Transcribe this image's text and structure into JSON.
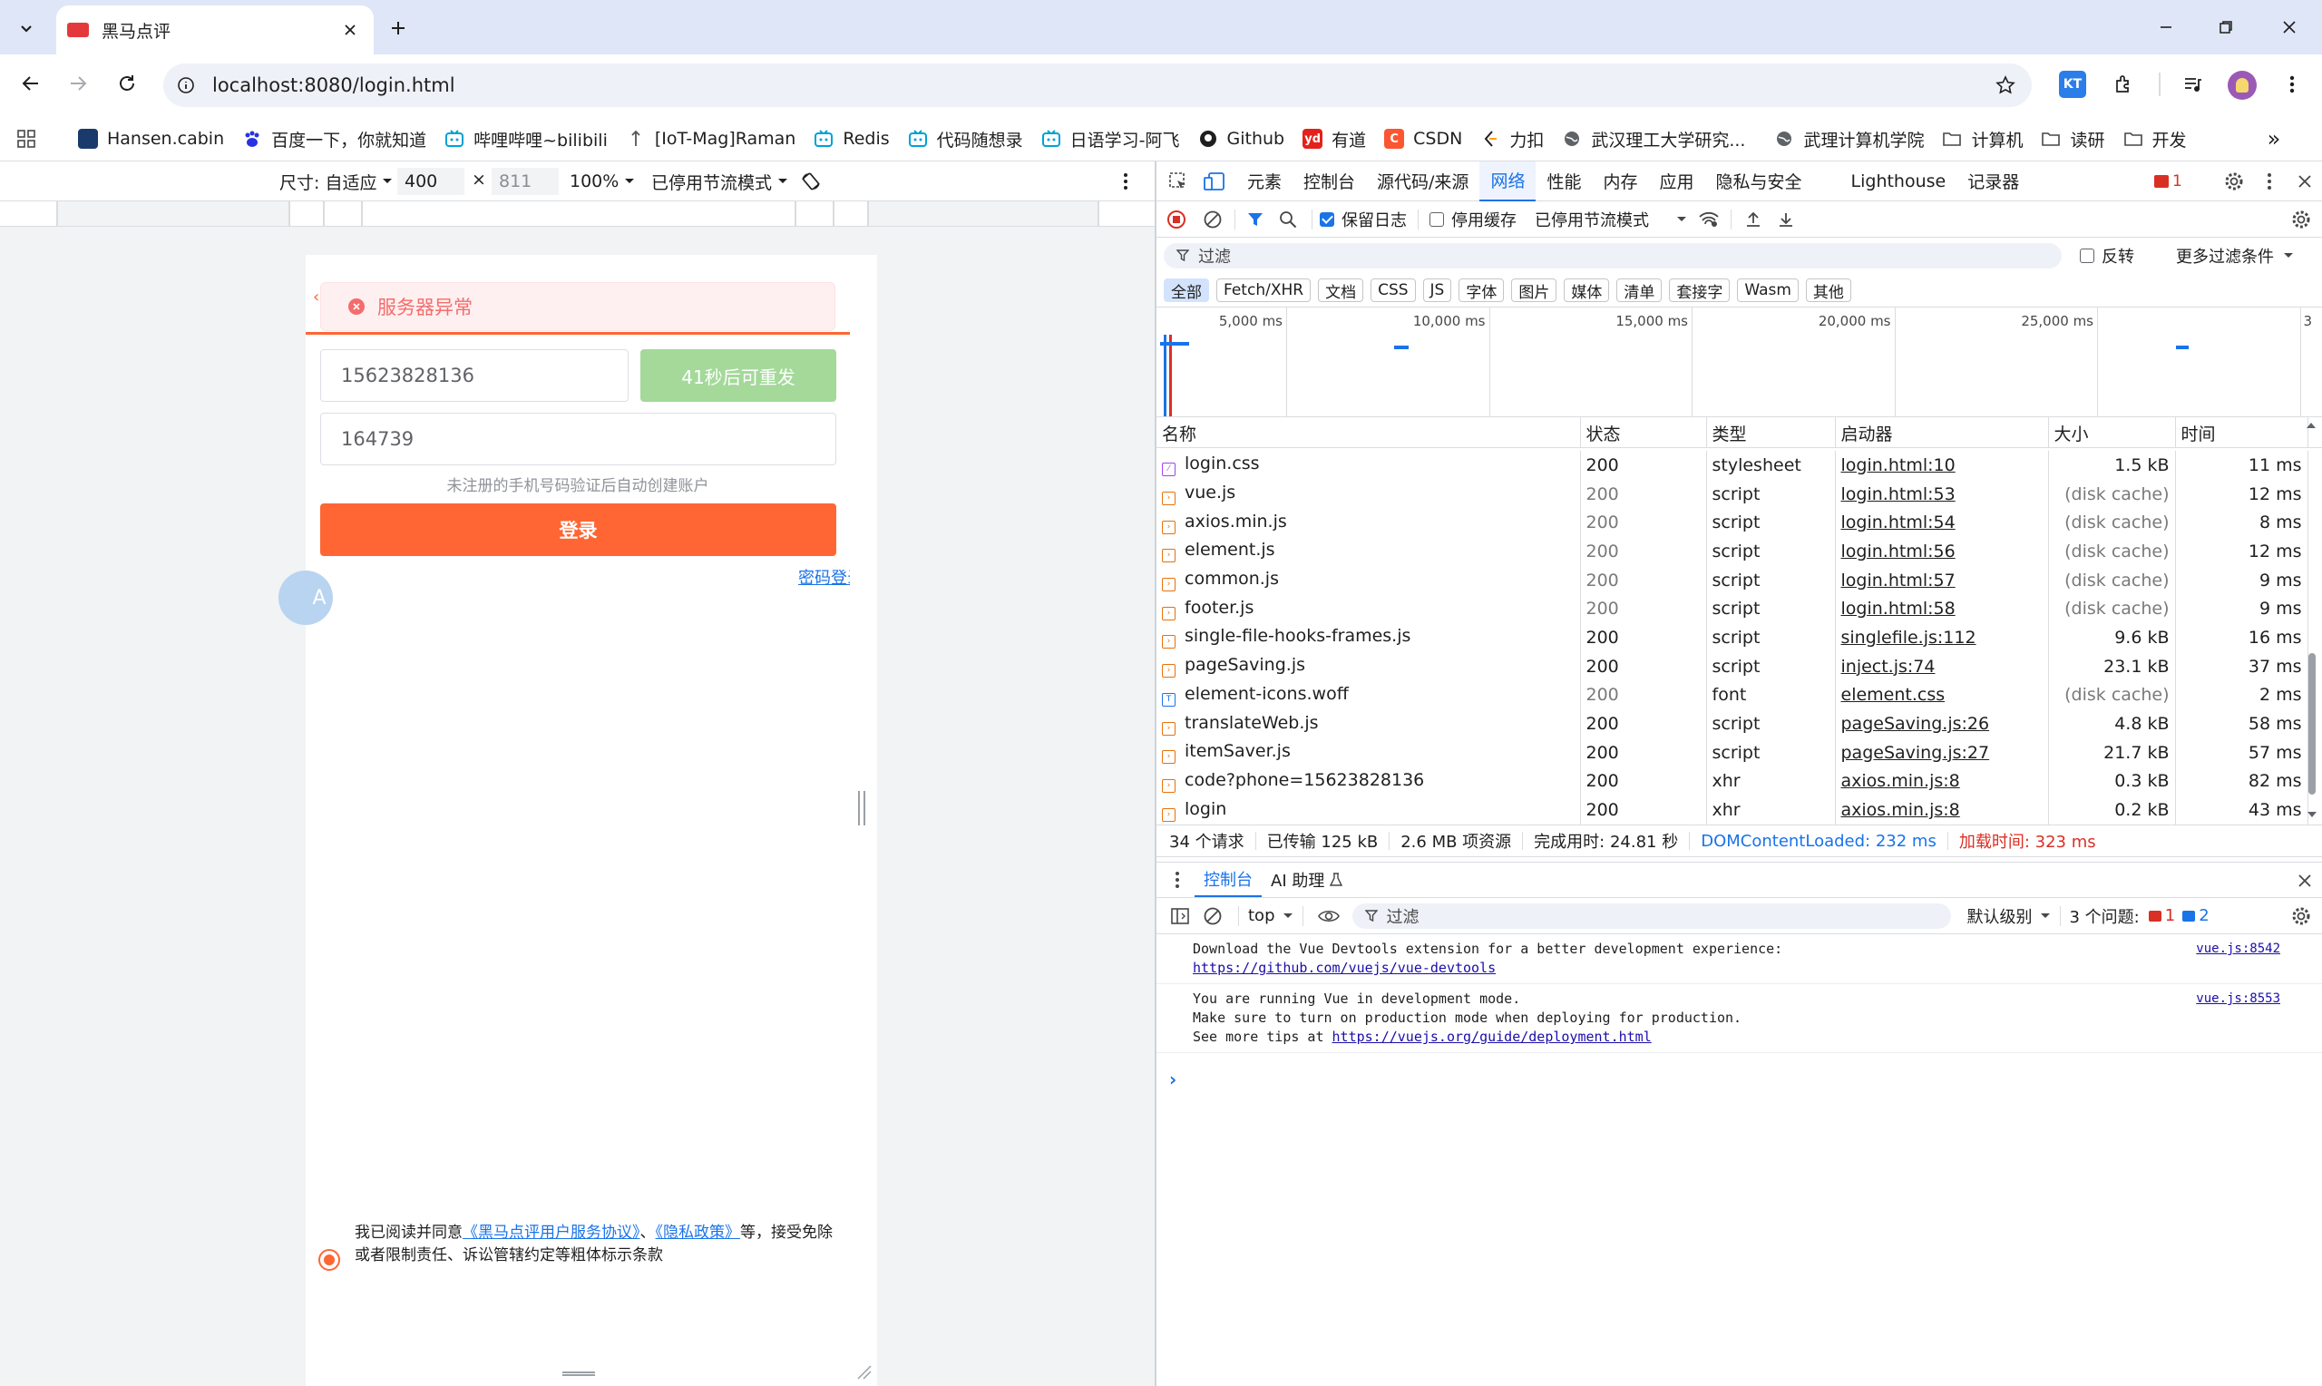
{
  "browser": {
    "tab_title": "黑马点评",
    "url": "localhost:8080/login.html",
    "bookmarks": [
      {
        "label": "Hansen.cabin",
        "icon": "hansen-icon",
        "color": "#1a3a6b"
      },
      {
        "label": "百度一下，你就知道",
        "icon": "baidu-icon",
        "color": "#2932e1"
      },
      {
        "label": "哔哩哔哩~bilibili",
        "icon": "bilibili-icon",
        "color": "#00a1d6"
      },
      {
        "label": "[IoT-Mag]Raman",
        "icon": "iot-icon",
        "color": "#555555"
      },
      {
        "label": "Redis",
        "icon": "bilibili-icon",
        "color": "#00a1d6"
      },
      {
        "label": "代码随想录",
        "icon": "bilibili-icon",
        "color": "#00a1d6"
      },
      {
        "label": "日语学习-阿飞",
        "icon": "bilibili-icon",
        "color": "#00a1d6"
      },
      {
        "label": "Github",
        "icon": "github-icon",
        "color": "#1f1f1f"
      },
      {
        "label": "有道",
        "icon": "youdao-icon",
        "color": "#e4211b"
      },
      {
        "label": "CSDN",
        "icon": "csdn-icon",
        "color": "#fc5531"
      },
      {
        "label": "力扣",
        "icon": "leetcode-icon",
        "color": "#ffa116"
      },
      {
        "label": "武汉理工大学研究...",
        "icon": "globe-icon",
        "color": "#5f6368"
      },
      {
        "label": "武理计算机学院",
        "icon": "globe-icon",
        "color": "#5f6368"
      },
      {
        "label": "计算机",
        "icon": "folder-icon",
        "color": "#5f6368"
      },
      {
        "label": "读研",
        "icon": "folder-icon",
        "color": "#5f6368"
      },
      {
        "label": "开发",
        "icon": "folder-icon",
        "color": "#5f6368"
      }
    ]
  },
  "device_bar": {
    "size_label": "尺寸: 自适应",
    "width": "400",
    "height": "811",
    "zoom": "100%",
    "throttle": "已停用节流模式"
  },
  "page": {
    "error_message": "服务器异常",
    "phone_value": "15623828136",
    "resend_label": "41秒后可重发",
    "code_value": "164739",
    "hint": "未注册的手机号码验证后自动创建账户",
    "login_label": "登录",
    "password_login": "密码登录",
    "agreement_prefix": "我已阅读并同意",
    "agreement_link1": "《黑马点评用户服务协议》",
    "agreement_sep": "、",
    "agreement_link2": "《隐私政策》",
    "agreement_suffix": "等，接受免除或者限制责任、诉讼管辖约定等粗体标示条款"
  },
  "devtools": {
    "tabs": [
      "元素",
      "控制台",
      "源代码/来源",
      "网络",
      "性能",
      "内存",
      "应用",
      "隐私与安全",
      "Lighthouse",
      "记录器"
    ],
    "active_tab": "网络",
    "error_count": "1",
    "preserve_log": "保留日志",
    "disable_cache": "停用缓存",
    "throttle": "已停用节流模式",
    "filter_placeholder": "过滤",
    "invert": "反转",
    "more_filters": "更多过滤条件",
    "type_filters": [
      "全部",
      "Fetch/XHR",
      "文档",
      "CSS",
      "JS",
      "字体",
      "图片",
      "媒体",
      "清单",
      "套接字",
      "Wasm",
      "其他"
    ],
    "timeline_ticks": [
      "5,000 ms",
      "10,000 ms",
      "15,000 ms",
      "20,000 ms",
      "25,000 ms",
      "3"
    ],
    "columns": [
      "名称",
      "状态",
      "类型",
      "启动器",
      "大小",
      "时间"
    ],
    "requests": [
      {
        "name": "login.css",
        "status": "200",
        "type": "stylesheet",
        "initiator": "login.html:10",
        "size": "1.5 kB",
        "time": "11 ms",
        "kind": "css",
        "cached": false
      },
      {
        "name": "vue.js",
        "status": "200",
        "type": "script",
        "initiator": "login.html:53",
        "size": "(disk cache)",
        "time": "12 ms",
        "kind": "js",
        "cached": true
      },
      {
        "name": "axios.min.js",
        "status": "200",
        "type": "script",
        "initiator": "login.html:54",
        "size": "(disk cache)",
        "time": "8 ms",
        "kind": "js",
        "cached": true
      },
      {
        "name": "element.js",
        "status": "200",
        "type": "script",
        "initiator": "login.html:56",
        "size": "(disk cache)",
        "time": "12 ms",
        "kind": "js",
        "cached": true
      },
      {
        "name": "common.js",
        "status": "200",
        "type": "script",
        "initiator": "login.html:57",
        "size": "(disk cache)",
        "time": "9 ms",
        "kind": "js",
        "cached": true
      },
      {
        "name": "footer.js",
        "status": "200",
        "type": "script",
        "initiator": "login.html:58",
        "size": "(disk cache)",
        "time": "9 ms",
        "kind": "js",
        "cached": true
      },
      {
        "name": "single-file-hooks-frames.js",
        "status": "200",
        "type": "script",
        "initiator": "singlefile.js:112",
        "size": "9.6 kB",
        "time": "16 ms",
        "kind": "js",
        "cached": false
      },
      {
        "name": "pageSaving.js",
        "status": "200",
        "type": "script",
        "initiator": "inject.js:74",
        "size": "23.1 kB",
        "time": "37 ms",
        "kind": "js",
        "cached": false
      },
      {
        "name": "element-icons.woff",
        "status": "200",
        "type": "font",
        "initiator": "element.css",
        "size": "(disk cache)",
        "time": "2 ms",
        "kind": "font",
        "cached": true
      },
      {
        "name": "translateWeb.js",
        "status": "200",
        "type": "script",
        "initiator": "pageSaving.js:26",
        "size": "4.8 kB",
        "time": "58 ms",
        "kind": "js",
        "cached": false
      },
      {
        "name": "itemSaver.js",
        "status": "200",
        "type": "script",
        "initiator": "pageSaving.js:27",
        "size": "21.7 kB",
        "time": "57 ms",
        "kind": "js",
        "cached": false
      },
      {
        "name": "code?phone=15623828136",
        "status": "200",
        "type": "xhr",
        "initiator": "axios.min.js:8",
        "size": "0.3 kB",
        "time": "82 ms",
        "kind": "xhr",
        "cached": false
      },
      {
        "name": "login",
        "status": "200",
        "type": "xhr",
        "initiator": "axios.min.js:8",
        "size": "0.2 kB",
        "time": "43 ms",
        "kind": "xhr",
        "cached": false
      }
    ],
    "summary": {
      "requests": "34 个请求",
      "transferred": "已传输 125 kB",
      "resources": "2.6 MB 项资源",
      "finish": "完成用时: 24.81 秒",
      "dcl": "DOMContentLoaded: 232 ms",
      "load": "加载时间: 323 ms"
    },
    "drawer": {
      "tabs": [
        "控制台",
        "AI 助理"
      ],
      "context": "top",
      "filter": "过滤",
      "level": "默认级别",
      "issues": "3 个问题:",
      "issue_errors": "1",
      "issue_infos": "2",
      "messages": [
        {
          "lines": [
            "Download the Vue Devtools extension for a better development experience:"
          ],
          "link": "https://github.com/vuejs/vue-devtools",
          "source": "vue.js:8542"
        },
        {
          "lines": [
            "You are running Vue in development mode.",
            "Make sure to turn on production mode when deploying for production.",
            "See more tips at "
          ],
          "link": "https://vuejs.org/guide/deployment.html",
          "source": "vue.js:8553"
        }
      ]
    }
  },
  "colors": {
    "accent": "#ff6633",
    "error_bg": "#fef0f0",
    "error_text": "#f56c6c",
    "resend_bg": "#a4d99a",
    "blue": "#1a73e8",
    "red": "#d93025"
  }
}
